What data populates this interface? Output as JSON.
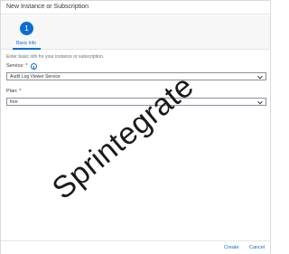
{
  "dialog": {
    "title": "New Instance or Subscription"
  },
  "wizard": {
    "steps": [
      {
        "number": "1",
        "label": "Basic Info"
      }
    ]
  },
  "form": {
    "intro": "Enter basic info for your instance or subscription.",
    "service": {
      "label": "Service:",
      "required_mark": "*",
      "value": "Audit Log Viewer Service"
    },
    "plan": {
      "label": "Plan:",
      "required_mark": "*",
      "value": "free"
    }
  },
  "watermark": "Sprintegrate",
  "footer": {
    "create_label": "Create",
    "cancel_label": "Cancel"
  },
  "colors": {
    "accent": "#0a6ed1",
    "required": "#bb0000"
  }
}
